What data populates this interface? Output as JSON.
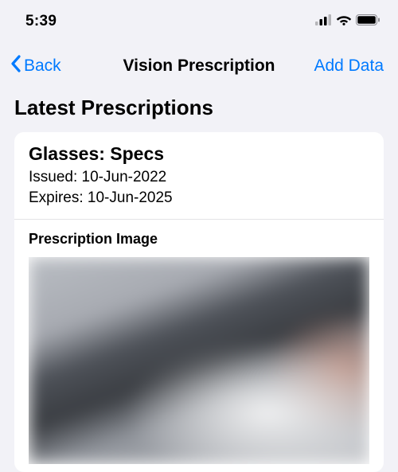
{
  "statusBar": {
    "time": "5:39"
  },
  "nav": {
    "back": "Back",
    "title": "Vision Prescription",
    "action": "Add Data"
  },
  "section": {
    "header": "Latest Prescriptions",
    "card": {
      "title": "Glasses: Specs",
      "issuedLabel": "Issued: 10-Jun-2022",
      "expiresLabel": "Expires: 10-Jun-2025",
      "imageHeader": "Prescription Image"
    }
  }
}
